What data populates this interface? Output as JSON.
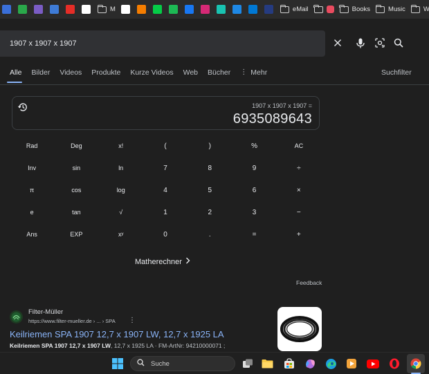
{
  "bookmarks": {
    "icon_items": [
      {
        "name": "bookmark-icon-1",
        "color": "#3a6fd8"
      },
      {
        "name": "bookmark-icon-2",
        "color": "#2aa84a"
      },
      {
        "name": "bookmark-icon-3",
        "color": "#7a5cc4"
      },
      {
        "name": "bookmark-icon-4",
        "color": "#3e7bd6"
      },
      {
        "name": "youtube-icon",
        "color": "#e52d27"
      },
      {
        "name": "google-icon",
        "color": "#ffffff"
      }
    ],
    "m_label": "M",
    "icon_items_2": [
      {
        "name": "x-icon",
        "color": "#ffffff"
      },
      {
        "name": "blogger-icon",
        "color": "#f57d00"
      },
      {
        "name": "deviantart-icon",
        "color": "#05cc47"
      },
      {
        "name": "bookmark-icon-green",
        "color": "#1db954"
      },
      {
        "name": "facebook-icon",
        "color": "#1877f2"
      },
      {
        "name": "instagram-icon",
        "color": "#d62976"
      },
      {
        "name": "pinterest-icon",
        "color": "#19c3b1"
      },
      {
        "name": "tumblr-icon",
        "color": "#1e88e5"
      },
      {
        "name": "skype-icon",
        "color": "#0078d4"
      },
      {
        "name": "paypal-icon",
        "color": "#253b80"
      }
    ],
    "folders": [
      {
        "label": "eMail"
      },
      {
        "label": ""
      },
      {
        "label": "Books"
      },
      {
        "label": "Music"
      },
      {
        "label": "Webcam"
      }
    ]
  },
  "search": {
    "value": "1907 x 1907 x 1907"
  },
  "tabs": [
    {
      "label": "Alle",
      "active": true
    },
    {
      "label": "Bilder"
    },
    {
      "label": "Videos"
    },
    {
      "label": "Produkte"
    },
    {
      "label": "Kurze Videos"
    },
    {
      "label": "Web"
    },
    {
      "label": "Bücher"
    },
    {
      "label": "Mehr"
    }
  ],
  "suchfilter": "Suchfilter",
  "calculator": {
    "expression": "1907 x 1907 x 1907 =",
    "result": "6935089643",
    "rows": [
      [
        "Rad",
        "Deg",
        "x!",
        "(",
        ")",
        "%",
        "AC"
      ],
      [
        "Inv",
        "sin",
        "ln",
        "7",
        "8",
        "9",
        "÷"
      ],
      [
        "π",
        "cos",
        "log",
        "4",
        "5",
        "6",
        "×"
      ],
      [
        "e",
        "tan",
        "√",
        "1",
        "2",
        "3",
        "−"
      ],
      [
        "Ans",
        "EXP",
        "xʸ",
        "0",
        ".",
        "=",
        "+"
      ]
    ],
    "math_link": "Matherechner",
    "feedback": "Feedback"
  },
  "result": {
    "site_name": "Filter-Müller",
    "url": "https://www.filter-mueller.de",
    "url_crumb": "› ... › SPA",
    "title": "Keilriemen SPA 1907 12,7 x 1907 LW, 12,7 x 1925 LA",
    "snippet_bold": "Keilriemen SPA 1907 12,7 x 1907 LW",
    "snippet_rest": ", 12,7 x 1925 LA · FM-ArtNr: 94210000071 ;"
  },
  "taskbar": {
    "search_label": "Suche"
  }
}
